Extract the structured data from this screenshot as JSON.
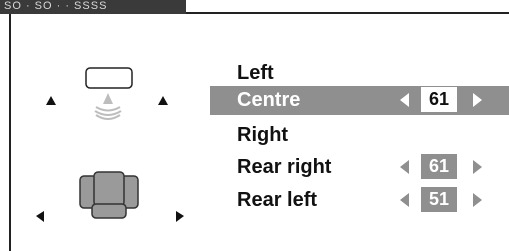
{
  "header": {
    "tab_text": "SO · SO · · SSSS"
  },
  "channels": [
    {
      "label": "Left",
      "value": null,
      "selected": false
    },
    {
      "label": "Centre",
      "value": "61",
      "selected": true
    },
    {
      "label": "Right",
      "value": null,
      "selected": false
    },
    {
      "label": "Rear right",
      "value": "61",
      "selected": false
    },
    {
      "label": "Rear left",
      "value": "51",
      "selected": false
    }
  ],
  "colors": {
    "highlight": "#8f8f8f",
    "text": "#111111",
    "frame": "#222222"
  },
  "icons": {
    "front_left": "speaker-front-left-icon",
    "front_right": "speaker-front-right-icon",
    "centre": "tv-screen-icon",
    "centre_sound": "sound-waves-icon",
    "listener": "armchair-icon",
    "rear_left": "speaker-rear-left-icon",
    "rear_right": "speaker-rear-right-icon"
  }
}
